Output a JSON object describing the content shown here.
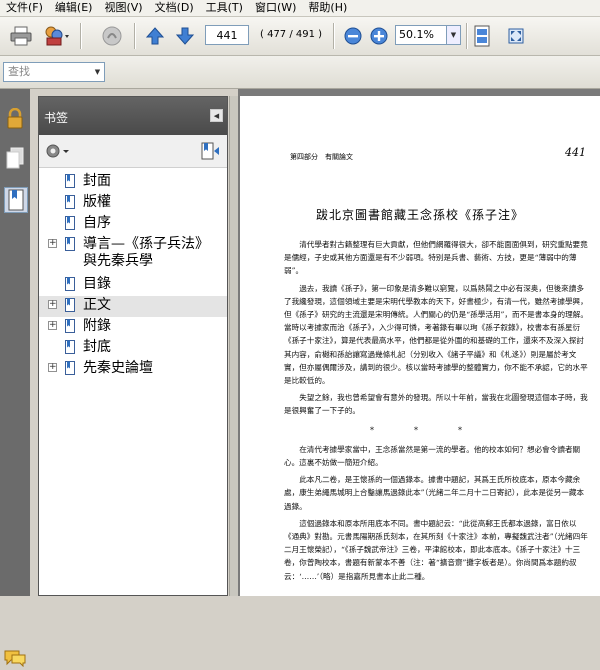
{
  "menu": [
    "文件(F)",
    "编辑(E)",
    "视图(V)",
    "文档(D)",
    "工具(T)",
    "窗口(W)",
    "帮助(H)"
  ],
  "toolbar": {
    "page_current": "441",
    "page_count": "( 477 / 491 )",
    "zoom": "50.1%"
  },
  "find": {
    "placeholder": "查找"
  },
  "bookmarks": {
    "title": "书签",
    "items": [
      {
        "label": "封面",
        "expandable": false
      },
      {
        "label": "版權",
        "expandable": false
      },
      {
        "label": "自序",
        "expandable": false
      },
      {
        "label": "導言—《孫子兵法》",
        "label2": "與先秦兵學",
        "expandable": true
      },
      {
        "label": "目錄",
        "expandable": false
      },
      {
        "label": "正文",
        "expandable": true
      },
      {
        "label": "附錄",
        "expandable": true
      },
      {
        "label": "封底",
        "expandable": false
      },
      {
        "label": "先秦史論壇",
        "expandable": true
      }
    ]
  },
  "document": {
    "running_head": "第四部分　有關論文",
    "page_number": "441",
    "title": "跋北京圖書館藏王念孫校《孫子注》",
    "paragraphs": [
      "清代學者對古籍整理有巨大貢獻，但他們網羅得很大，卻不能面面俱到，研究重點要竟是儒經，子史或其他方面還是有不少弱項。特别是兵書、藝術、方技，更是“薄弱中的薄弱”。",
      "過去，我讀《孫子》，第一印象是清多難以窮覽，以爲熱鬧之中必有深奥，但後來讀多了我纔發現，這個領域主要是宋明代學教本的天下，好書極少，有清一代，雖然考據學興，但《孫子》研究的主流還是宋明傳統。人們關心的仍是“孫學活用”，而不是書本身的理解。當時以考據家而治《孫子》，入少得可憐，考著錄有畢以珣《孫子叙錄》，校書本有孫星衍《孫子十家注》，算是代表最高水平，他們都是從外圍的和基礎的工作，還來不及深入探討其内容，俞樾和孫詒讓寫過幾條札記（分别收入《諸子平議》和《札迻》）則是屬於考文實，但亦屬偶爾涉及，講到的很少。核以當時考據學的整體實力，你不能不承認，它的水平是比較低的。",
      "失望之餘，我也曾希望會有意外的發現。所以十年前，當我在北圖發現這個本子時，我是很興奮了一下子的。",
      "在清代考據學家當中，王念孫當然是第一流的學者。他的校本如何？想必會令讀者關心。這裏不妨做一簡短介紹。",
      "此本凡二卷，是王懷孫的一個過錄本。據書中題記，其爲王氏所校底本，原本今藏余處，康生弟繩馬城明上合鑿讓馬過錄此本”（光緒二年二月十二日寄記），此本是從另一藏本過錄。",
      "這個過錄本和原本所用底本不同。書中題記云：“此從高郵王氏都本過錄，富日依以《通典》對勘。元書馬陽期孫氏刻本，在其所刻《十家注》本前，專擬魏武注者”（光緒四年二月王懷榮記），“《孫子魏武帝注》三卷，平津館校本，即此本底本。《孫子十家注》十三卷，你曾陶校本，書題有新蒙本不善（注：著“擴音齋”攤字板者是）。你尚間爲本題約叔云：‘……’（略）是指嘉所見書本止此二種。"
    ]
  }
}
